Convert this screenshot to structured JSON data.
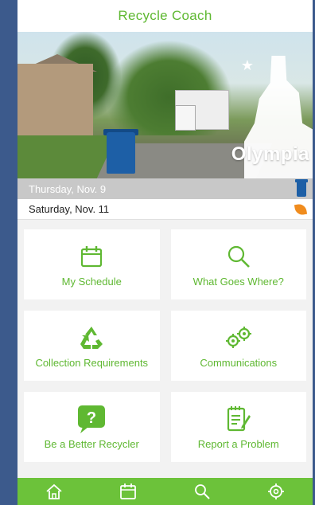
{
  "app": {
    "title": "Recycle Coach"
  },
  "hero": {
    "city_name": "Olympia"
  },
  "colors": {
    "brand_green": "#5fb832",
    "tab_green": "#6cc23a",
    "cart_blue": "#1d5fa6",
    "leaf_orange": "#f08c1e"
  },
  "pickups": [
    {
      "date": "Thursday, Nov. 9",
      "icon": "blue-cart-icon",
      "state": "current"
    },
    {
      "date": "Saturday, Nov. 11",
      "icon": "yard-waste-leaf-icon",
      "state": "upcoming"
    }
  ],
  "tiles": [
    {
      "label": "My Schedule",
      "icon": "calendar-icon"
    },
    {
      "label": "What Goes Where?",
      "icon": "magnifier-icon"
    },
    {
      "label": "Collection Requirements",
      "icon": "recycle-icon"
    },
    {
      "label": "Communications",
      "icon": "gears-icon"
    },
    {
      "label": "Be a Better Recycler",
      "icon": "question-bubble-icon"
    },
    {
      "label": "Report a Problem",
      "icon": "notepad-pencil-icon"
    }
  ],
  "tabbar": [
    {
      "icon": "home-icon"
    },
    {
      "icon": "calendar-icon"
    },
    {
      "icon": "search-icon"
    },
    {
      "icon": "settings-gear-icon"
    }
  ]
}
